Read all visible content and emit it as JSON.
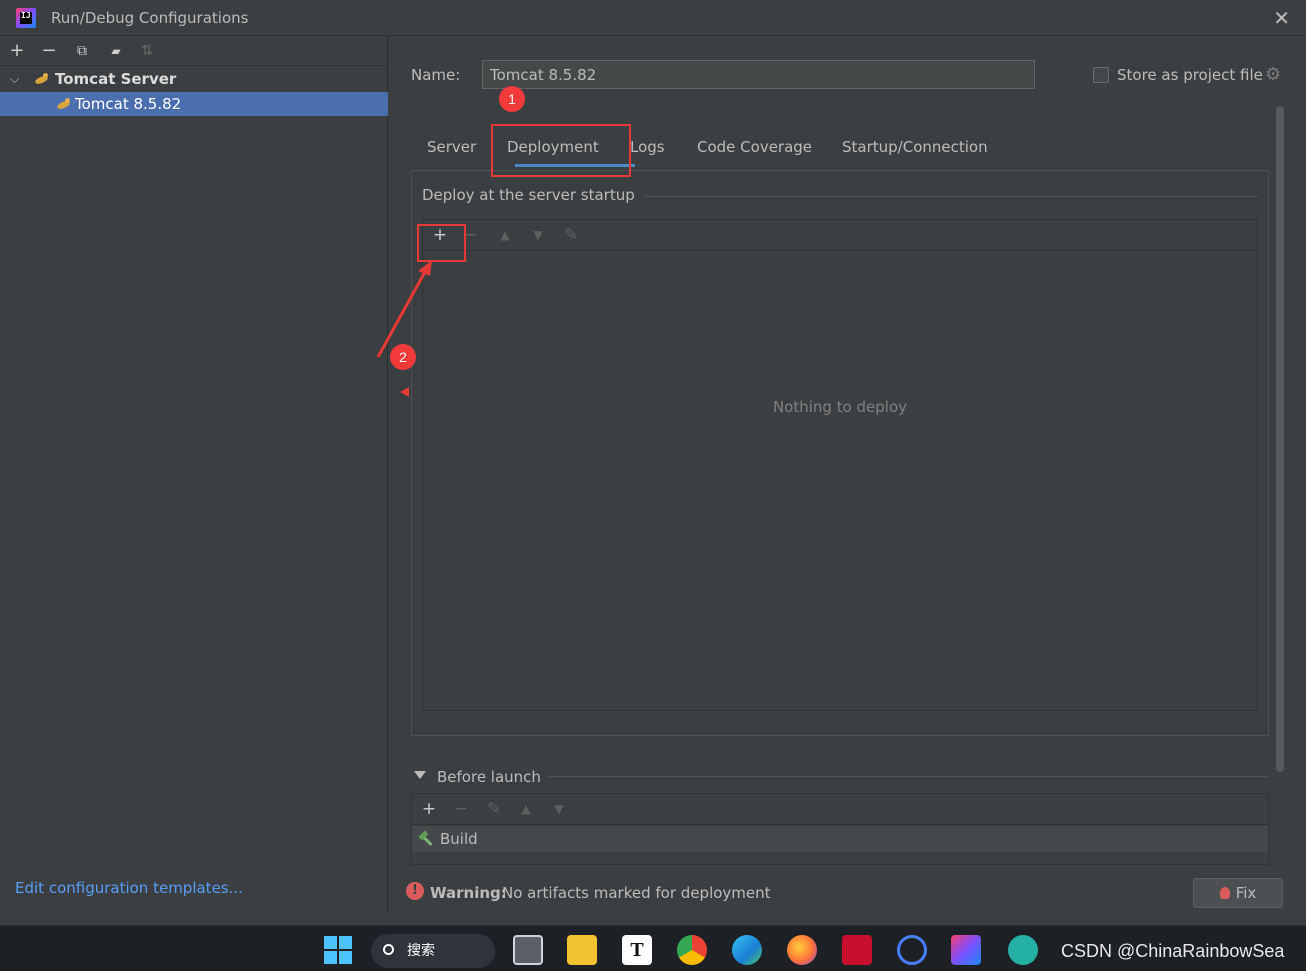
{
  "window": {
    "title": "Run/Debug Configurations",
    "app_icon_text": "IJ"
  },
  "left": {
    "toolbar": {
      "add": "+",
      "remove": "−",
      "copy": "⧉",
      "folder": "▰",
      "sort": "⇅"
    },
    "tree": {
      "group": "Tomcat Server",
      "item": "Tomcat 8.5.82"
    },
    "edit_templates": "Edit configuration templates..."
  },
  "right": {
    "name_label": "Name:",
    "name_value": "Tomcat 8.5.82",
    "store_label": "Store as project file",
    "tabs": [
      "Server",
      "Deployment",
      "Logs",
      "Code Coverage",
      "Startup/Connection"
    ],
    "active_tab": "Deployment",
    "deploy_title": "Deploy at the server startup",
    "deploy_toolbar": {
      "add": "+",
      "remove": "−",
      "up": "▲",
      "down": "▼",
      "edit": "✎"
    },
    "empty_text": "Nothing to deploy",
    "before_launch": "Before launch",
    "before_launch_items": [
      "Build"
    ],
    "warning_bold": "Warning:",
    "warning_text": "No artifacts marked for deployment",
    "fix_label": "Fix"
  },
  "annotations": {
    "badge1": "1",
    "badge2": "2",
    "color": "#e53935"
  },
  "taskbar": {
    "search_label": "搜索",
    "watermark": "CSDN @ChinaRainbowSea"
  },
  "colors": {
    "background": "#3c3f41",
    "selection": "#4b6eaf",
    "link": "#589df6",
    "tab_underline": "#4a88c7",
    "error": "#db5c5c"
  }
}
